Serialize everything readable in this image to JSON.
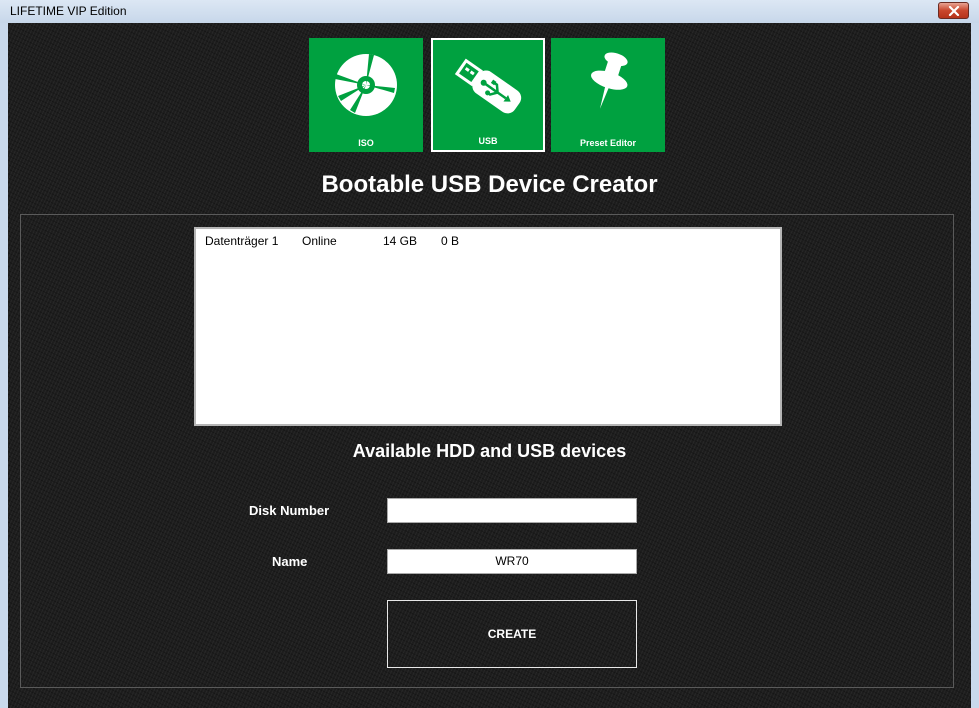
{
  "window": {
    "title": "LIFETIME VIP Edition"
  },
  "tiles": [
    {
      "label": "ISO",
      "icon": "disc-icon"
    },
    {
      "label": "USB",
      "icon": "usb-stick-icon"
    },
    {
      "label": "Preset Editor",
      "icon": "pushpin-icon"
    }
  ],
  "main": {
    "heading": "Bootable USB Device Creator",
    "devices_caption": "Available HDD and USB devices",
    "devices": [
      {
        "name": "Datenträger 1",
        "status": "Online",
        "size": "14 GB",
        "free": "0 B"
      }
    ],
    "disk_number_label": "Disk Number",
    "disk_number_value": "",
    "name_label": "Name",
    "name_value": "WR70",
    "create_label": "CREATE"
  },
  "colors": {
    "tile_green": "#00a140",
    "background": "#1d1d1d",
    "close_red": "#c9462c"
  }
}
